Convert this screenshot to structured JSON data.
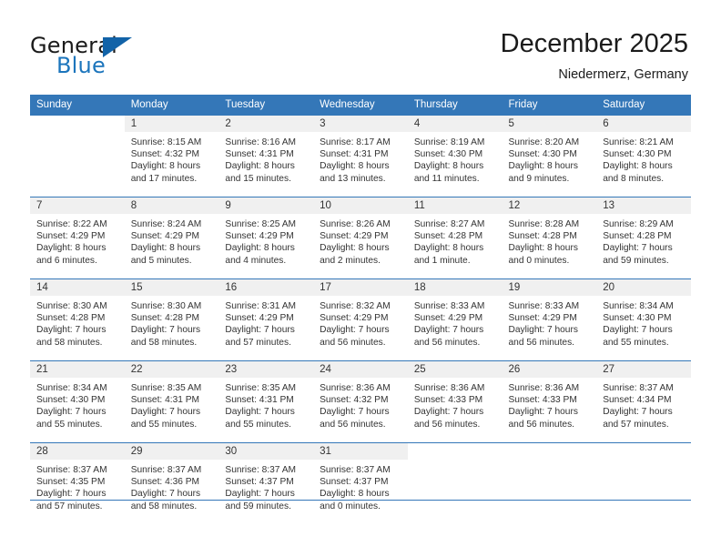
{
  "brand": {
    "word1": "General",
    "word2": "Blue",
    "logo_icon": "triangle-logo-icon",
    "accent_color": "#1c75bc"
  },
  "header": {
    "title": "December 2025",
    "subtitle": "Niedermerz, Germany"
  },
  "theme": {
    "header_row_bg": "#3477b8",
    "daynum_band_bg": "#f0f0f0",
    "grid_line": "#3477b8",
    "text": "#333333"
  },
  "calendar": {
    "weekday_headers": [
      "Sunday",
      "Monday",
      "Tuesday",
      "Wednesday",
      "Thursday",
      "Friday",
      "Saturday"
    ],
    "weeks": [
      [
        {
          "day": "",
          "lines": []
        },
        {
          "day": "1",
          "lines": [
            "Sunrise: 8:15 AM",
            "Sunset: 4:32 PM",
            "Daylight: 8 hours",
            "and 17 minutes."
          ]
        },
        {
          "day": "2",
          "lines": [
            "Sunrise: 8:16 AM",
            "Sunset: 4:31 PM",
            "Daylight: 8 hours",
            "and 15 minutes."
          ]
        },
        {
          "day": "3",
          "lines": [
            "Sunrise: 8:17 AM",
            "Sunset: 4:31 PM",
            "Daylight: 8 hours",
            "and 13 minutes."
          ]
        },
        {
          "day": "4",
          "lines": [
            "Sunrise: 8:19 AM",
            "Sunset: 4:30 PM",
            "Daylight: 8 hours",
            "and 11 minutes."
          ]
        },
        {
          "day": "5",
          "lines": [
            "Sunrise: 8:20 AM",
            "Sunset: 4:30 PM",
            "Daylight: 8 hours",
            "and 9 minutes."
          ]
        },
        {
          "day": "6",
          "lines": [
            "Sunrise: 8:21 AM",
            "Sunset: 4:30 PM",
            "Daylight: 8 hours",
            "and 8 minutes."
          ]
        }
      ],
      [
        {
          "day": "7",
          "lines": [
            "Sunrise: 8:22 AM",
            "Sunset: 4:29 PM",
            "Daylight: 8 hours",
            "and 6 minutes."
          ]
        },
        {
          "day": "8",
          "lines": [
            "Sunrise: 8:24 AM",
            "Sunset: 4:29 PM",
            "Daylight: 8 hours",
            "and 5 minutes."
          ]
        },
        {
          "day": "9",
          "lines": [
            "Sunrise: 8:25 AM",
            "Sunset: 4:29 PM",
            "Daylight: 8 hours",
            "and 4 minutes."
          ]
        },
        {
          "day": "10",
          "lines": [
            "Sunrise: 8:26 AM",
            "Sunset: 4:29 PM",
            "Daylight: 8 hours",
            "and 2 minutes."
          ]
        },
        {
          "day": "11",
          "lines": [
            "Sunrise: 8:27 AM",
            "Sunset: 4:28 PM",
            "Daylight: 8 hours",
            "and 1 minute."
          ]
        },
        {
          "day": "12",
          "lines": [
            "Sunrise: 8:28 AM",
            "Sunset: 4:28 PM",
            "Daylight: 8 hours",
            "and 0 minutes."
          ]
        },
        {
          "day": "13",
          "lines": [
            "Sunrise: 8:29 AM",
            "Sunset: 4:28 PM",
            "Daylight: 7 hours",
            "and 59 minutes."
          ]
        }
      ],
      [
        {
          "day": "14",
          "lines": [
            "Sunrise: 8:30 AM",
            "Sunset: 4:28 PM",
            "Daylight: 7 hours",
            "and 58 minutes."
          ]
        },
        {
          "day": "15",
          "lines": [
            "Sunrise: 8:30 AM",
            "Sunset: 4:28 PM",
            "Daylight: 7 hours",
            "and 58 minutes."
          ]
        },
        {
          "day": "16",
          "lines": [
            "Sunrise: 8:31 AM",
            "Sunset: 4:29 PM",
            "Daylight: 7 hours",
            "and 57 minutes."
          ]
        },
        {
          "day": "17",
          "lines": [
            "Sunrise: 8:32 AM",
            "Sunset: 4:29 PM",
            "Daylight: 7 hours",
            "and 56 minutes."
          ]
        },
        {
          "day": "18",
          "lines": [
            "Sunrise: 8:33 AM",
            "Sunset: 4:29 PM",
            "Daylight: 7 hours",
            "and 56 minutes."
          ]
        },
        {
          "day": "19",
          "lines": [
            "Sunrise: 8:33 AM",
            "Sunset: 4:29 PM",
            "Daylight: 7 hours",
            "and 56 minutes."
          ]
        },
        {
          "day": "20",
          "lines": [
            "Sunrise: 8:34 AM",
            "Sunset: 4:30 PM",
            "Daylight: 7 hours",
            "and 55 minutes."
          ]
        }
      ],
      [
        {
          "day": "21",
          "lines": [
            "Sunrise: 8:34 AM",
            "Sunset: 4:30 PM",
            "Daylight: 7 hours",
            "and 55 minutes."
          ]
        },
        {
          "day": "22",
          "lines": [
            "Sunrise: 8:35 AM",
            "Sunset: 4:31 PM",
            "Daylight: 7 hours",
            "and 55 minutes."
          ]
        },
        {
          "day": "23",
          "lines": [
            "Sunrise: 8:35 AM",
            "Sunset: 4:31 PM",
            "Daylight: 7 hours",
            "and 55 minutes."
          ]
        },
        {
          "day": "24",
          "lines": [
            "Sunrise: 8:36 AM",
            "Sunset: 4:32 PM",
            "Daylight: 7 hours",
            "and 56 minutes."
          ]
        },
        {
          "day": "25",
          "lines": [
            "Sunrise: 8:36 AM",
            "Sunset: 4:33 PM",
            "Daylight: 7 hours",
            "and 56 minutes."
          ]
        },
        {
          "day": "26",
          "lines": [
            "Sunrise: 8:36 AM",
            "Sunset: 4:33 PM",
            "Daylight: 7 hours",
            "and 56 minutes."
          ]
        },
        {
          "day": "27",
          "lines": [
            "Sunrise: 8:37 AM",
            "Sunset: 4:34 PM",
            "Daylight: 7 hours",
            "and 57 minutes."
          ]
        }
      ],
      [
        {
          "day": "28",
          "lines": [
            "Sunrise: 8:37 AM",
            "Sunset: 4:35 PM",
            "Daylight: 7 hours",
            "and 57 minutes."
          ]
        },
        {
          "day": "29",
          "lines": [
            "Sunrise: 8:37 AM",
            "Sunset: 4:36 PM",
            "Daylight: 7 hours",
            "and 58 minutes."
          ]
        },
        {
          "day": "30",
          "lines": [
            "Sunrise: 8:37 AM",
            "Sunset: 4:37 PM",
            "Daylight: 7 hours",
            "and 59 minutes."
          ]
        },
        {
          "day": "31",
          "lines": [
            "Sunrise: 8:37 AM",
            "Sunset: 4:37 PM",
            "Daylight: 8 hours",
            "and 0 minutes."
          ]
        },
        {
          "day": "",
          "lines": []
        },
        {
          "day": "",
          "lines": []
        },
        {
          "day": "",
          "lines": []
        }
      ]
    ]
  }
}
